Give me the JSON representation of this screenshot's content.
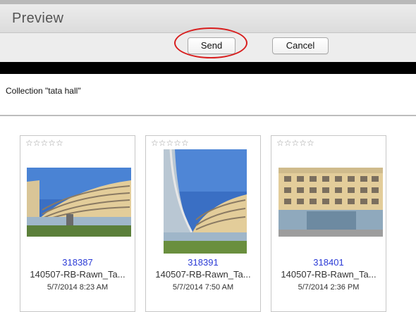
{
  "window": {
    "title": "Preview"
  },
  "toolbar": {
    "send_label": "Send",
    "cancel_label": "Cancel",
    "highlight_color": "#d81e1e"
  },
  "collection": {
    "label": "Collection \"tata hall\""
  },
  "cards": [
    {
      "stars": "☆☆☆☆☆",
      "id": "318387",
      "filename": "140507-RB-Rawn_Ta...",
      "date": "5/7/2014 8:23 AM"
    },
    {
      "stars": "☆☆☆☆☆",
      "id": "318391",
      "filename": "140507-RB-Rawn_Ta...",
      "date": "5/7/2014 7:50 AM"
    },
    {
      "stars": "☆☆☆☆☆",
      "id": "318401",
      "filename": "140507-RB-Rawn_Ta...",
      "date": "5/7/2014 2:36 PM"
    }
  ],
  "colors": {
    "id_link": "#2a3ad6",
    "sky": "#3a6fc4",
    "facade": "#e3cd9a"
  }
}
